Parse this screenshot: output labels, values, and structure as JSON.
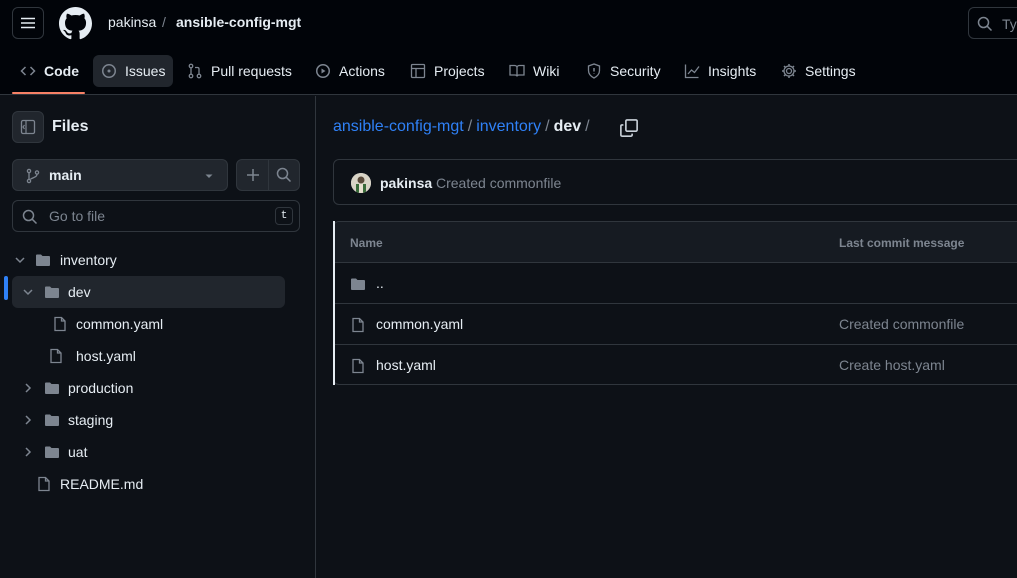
{
  "header": {
    "owner": "pakinsa",
    "separator": "/",
    "repo": "ansible-config-mgt",
    "search_placeholder": "Type"
  },
  "nav": [
    {
      "label": "Code",
      "icon": "code-icon",
      "active": true
    },
    {
      "label": "Issues",
      "icon": "issue-icon"
    },
    {
      "label": "Pull requests",
      "icon": "pull-request-icon"
    },
    {
      "label": "Actions",
      "icon": "play-icon"
    },
    {
      "label": "Projects",
      "icon": "table-icon"
    },
    {
      "label": "Wiki",
      "icon": "book-icon"
    },
    {
      "label": "Security",
      "icon": "shield-icon"
    },
    {
      "label": "Insights",
      "icon": "graph-icon"
    },
    {
      "label": "Settings",
      "icon": "gear-icon"
    }
  ],
  "sidebar": {
    "title": "Files",
    "branch": "main",
    "goto_placeholder": "Go to file",
    "goto_shortcut": "t",
    "tree": [
      {
        "label": "inventory",
        "type": "folder",
        "expanded": true
      },
      {
        "label": "dev",
        "type": "folder",
        "expanded": true,
        "selected": true
      },
      {
        "label": "common.yaml",
        "type": "file"
      },
      {
        "label": "host.yaml",
        "type": "file"
      },
      {
        "label": "production",
        "type": "folder",
        "expanded": false
      },
      {
        "label": "staging",
        "type": "folder",
        "expanded": false
      },
      {
        "label": "uat",
        "type": "folder",
        "expanded": false
      },
      {
        "label": "README.md",
        "type": "file"
      }
    ]
  },
  "breadcrumb": {
    "repo": "ansible-config-mgt",
    "folder": "inventory",
    "current": "dev",
    "sep": "/"
  },
  "commit": {
    "author": "pakinsa",
    "message": "Created commonfile"
  },
  "table": {
    "col_name": "Name",
    "col_message": "Last commit message",
    "rows": [
      {
        "name": "..",
        "type": "parent",
        "message": ""
      },
      {
        "name": "common.yaml",
        "type": "file",
        "message": "Created commonfile"
      },
      {
        "name": "host.yaml",
        "type": "file",
        "message": "Create host.yaml"
      }
    ]
  },
  "colors": {
    "background": "#0d1117",
    "header": "#010409",
    "accent": "#2f81f7",
    "underline": "#f78166",
    "muted": "#7d8590",
    "border": "#30363d"
  }
}
